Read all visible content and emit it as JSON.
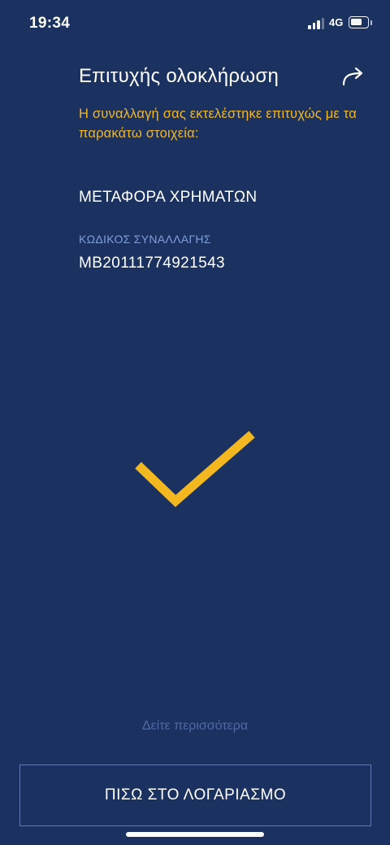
{
  "status_bar": {
    "time": "19:34",
    "network": "4G",
    "icons": [
      "signal-icon",
      "battery-icon"
    ],
    "battery_level": 0.7,
    "signal_bars": 3
  },
  "header": {
    "title": "Επιτυχής ολοκλήρωση",
    "share_icon": "share-arrow-icon",
    "subtitle": "Η συναλλαγή σας εκτελέστηκε επιτυχώς με τα παρακάτω στοιχεία:"
  },
  "transaction": {
    "type": "ΜΕΤΑΦΟΡΑ ΧΡΗΜΑΤΩΝ",
    "code_label": "ΚΩΔΙΚΟΣ ΣΥΝΑΛΛΑΓΗΣ",
    "code_value": "MB20111774921543"
  },
  "status_icon": "checkmark-icon",
  "footer": {
    "see_more": "Δείτε περισσότερα",
    "back_button": "ΠΙΣΩ ΣΤΟ ΛΟΓΑΡΙΑΣΜΟ"
  },
  "colors": {
    "background": "#1b3160",
    "accent": "#f3b820",
    "label": "#7f9fdb",
    "muted_link": "#4d6aa7"
  }
}
